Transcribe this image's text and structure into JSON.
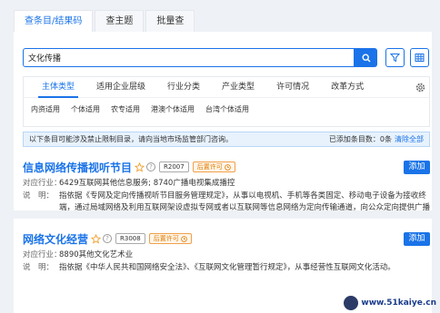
{
  "top_tabs": [
    "查条目/结果码",
    "查主题",
    "批量查"
  ],
  "search": {
    "value": "文化传播"
  },
  "filter_tabs": [
    "主体类型",
    "适用企业层级",
    "行业分类",
    "产业类型",
    "许可情况",
    "改革方式"
  ],
  "filter_options": [
    "内资适用",
    "个体适用",
    "农专适用",
    "港澳个体适用",
    "台湾个体适用"
  ],
  "notice": {
    "text": "以下条目可能涉及禁止限制目录，请向当地市场监管部门咨询。",
    "selected_label": "已添加条目数：",
    "selected_count": "0条",
    "clear": "清除全部"
  },
  "results": [
    {
      "title": "信息网络传播视听节目",
      "code": "R2007",
      "license": "后置许可",
      "industry_key": "对应行业：",
      "industry": "6429互联网其他信息服务; 8740广播电视集成播控",
      "desc_key": "说　明：",
      "desc": "指依据《专网及定向传播视听节目服务管理规定》，从事以电视机、手机等各类固定、移动电子设备为接收终端，通过局域网络及利用互联网架设虚拟专网或者以互联网等信息网络为定向传输通道，向公众定向提供广播电视节目等视听节目服务活动，包括以交互式网络电视（IPTV）、专网手机电视、互联网电视等形式从事内容提供、集成播控、传输分发等活动。",
      "add": "添加"
    },
    {
      "title": "网络文化经营",
      "code": "R3008",
      "license": "后置许可",
      "industry_key": "对应行业：",
      "industry": "8890其他文化艺术业",
      "desc_key": "说　明：",
      "desc": "指依据《中华人民共和国网络安全法》、《互联网文化管理暂行规定》，从事经营性互联网文化活动。",
      "add": "添加"
    }
  ],
  "help_mark": "?",
  "watermark": "www.51kaiye.cn"
}
